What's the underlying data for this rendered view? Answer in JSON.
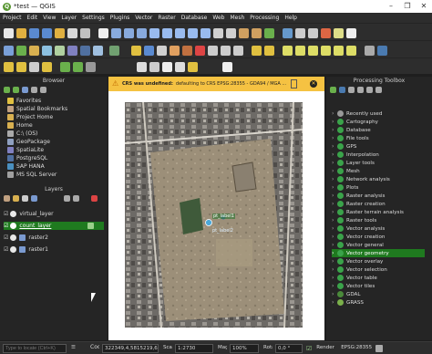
{
  "window": {
    "title": "*test — QGIS",
    "controls": [
      "–",
      "❐",
      "✕"
    ]
  },
  "menu": [
    "Project",
    "Edit",
    "View",
    "Layer",
    "Settings",
    "Plugins",
    "Vector",
    "Raster",
    "Database",
    "Web",
    "Mesh",
    "Processing",
    "Help"
  ],
  "browser": {
    "title": "Browser",
    "items": [
      "Favorites",
      "Spatial Bookmarks",
      "Project Home",
      "Home",
      "C:\\ (OS)",
      "GeoPackage",
      "SpatiaLite",
      "PostgreSQL",
      "SAP HANA",
      "MS SQL Server"
    ]
  },
  "layers": {
    "title": "Layers",
    "items": [
      "virtual_layer",
      "count_layer",
      "raster2",
      "raster1"
    ],
    "selected": "count_layer"
  },
  "warning": {
    "bold": "CRS was undefined:",
    "text": "defaulting to CRS EPSG:28355 - GDA94 / MGA ..."
  },
  "map": {
    "labels": [
      "pt_label1",
      "pt_label2"
    ]
  },
  "toolbox": {
    "title": "Processing Toolbox",
    "items": [
      "Recently used",
      "Cartography",
      "Database",
      "File tools",
      "GPS",
      "Interpolation",
      "Layer tools",
      "Mesh",
      "Network analysis",
      "Plots",
      "Raster analysis",
      "Raster creation",
      "Raster terrain analysis",
      "Raster tools",
      "Vector analysis",
      "Vector creation",
      "Vector general",
      "Vector geometry",
      "Vector overlay",
      "Vector selection",
      "Vector table",
      "Vector tiles",
      "GDAL",
      "GRASS"
    ],
    "selected": "Vector geometry"
  },
  "status": {
    "locator_placeholder": "Type to locate (Ctrl+K)",
    "coordinate_label": "Coordinate",
    "coordinate": "322349,4,5815219,6",
    "scale_label": "Scale",
    "scale": "1:2730",
    "magnifier_label": "Magnifier",
    "magnifier": "100%",
    "rotation_label": "Rotation",
    "rotation": "0,0 °",
    "render_label": "Render",
    "crs": "EPSG:28355"
  },
  "colors": {
    "accent_green": "#589632",
    "warning": "#f5c242",
    "selection": "#1f7a1f"
  }
}
